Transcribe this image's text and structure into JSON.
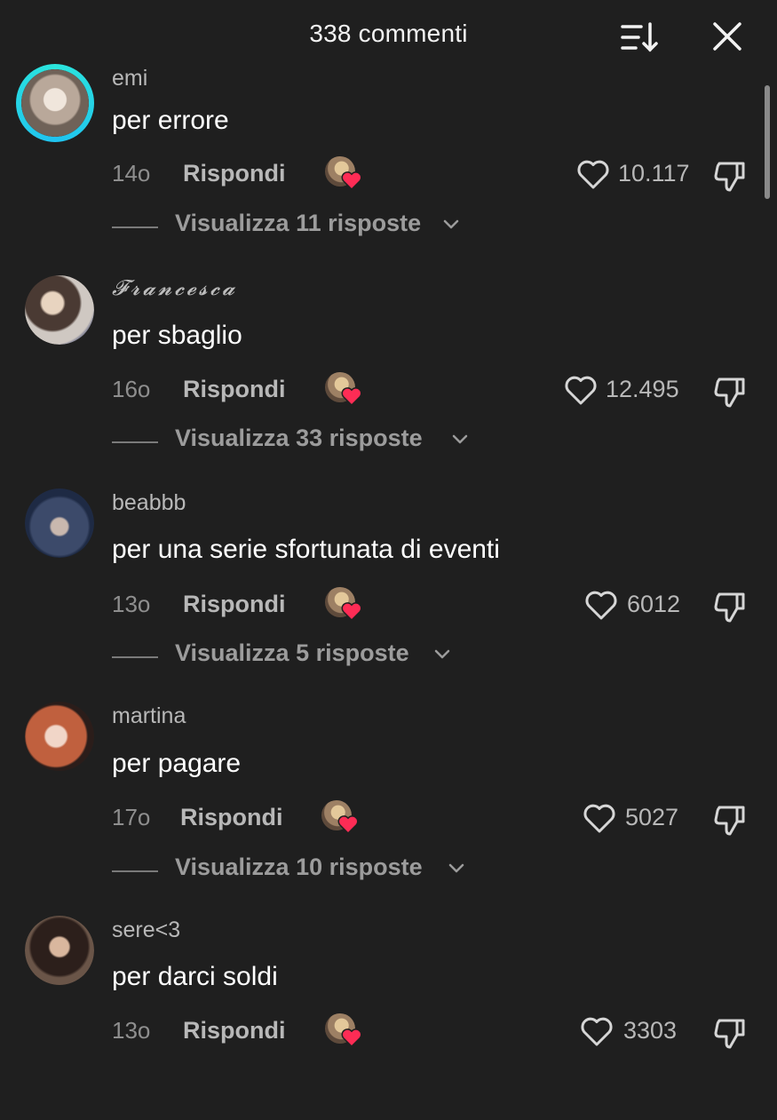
{
  "header": {
    "title": "338 commenti",
    "sort_icon": "sort-descending-icon",
    "close_icon": "close-icon"
  },
  "colors": {
    "background": "#1f1f1f",
    "accent_ring": "#2be5dc",
    "heart": "#fe2c55",
    "muted": "#8e8e8e"
  },
  "comments": [
    {
      "username": "emi",
      "text": "per errore",
      "time": "14o",
      "reply_label": "Rispondi",
      "likes": "10.117",
      "replies_label": "Visualizza 11 risposte",
      "avatar_ring": true
    },
    {
      "username": "𝓕𝓻𝓪𝓷𝓬𝓮𝓼𝓬𝓪",
      "text": "per sbaglio",
      "time": "16o",
      "reply_label": "Rispondi",
      "likes": "12.495",
      "replies_label": "Visualizza 33 risposte",
      "avatar_ring": false
    },
    {
      "username": "beabbb",
      "text": "per una serie sfortunata di eventi",
      "time": "13o",
      "reply_label": "Rispondi",
      "likes": "6012",
      "replies_label": "Visualizza 5 risposte",
      "avatar_ring": false
    },
    {
      "username": "martina",
      "text": "per pagare",
      "time": "17o",
      "reply_label": "Rispondi",
      "likes": "5027",
      "replies_label": "Visualizza 10 risposte",
      "avatar_ring": false
    },
    {
      "username": "sere<3",
      "text": "per darci soldi",
      "time": "13o",
      "reply_label": "Rispondi",
      "likes": "3303",
      "replies_label": "",
      "avatar_ring": false
    }
  ]
}
